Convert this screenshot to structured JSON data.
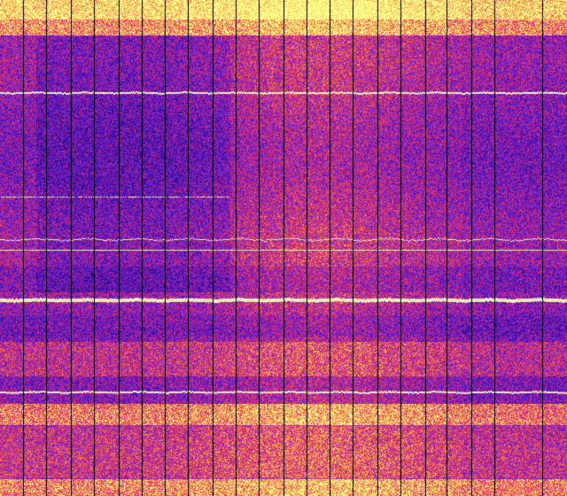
{
  "image": {
    "kind": "spectrogram-waterfall",
    "palette": [
      "#2a0a6e",
      "#3a10c8",
      "#7a20c0",
      "#c02890",
      "#f04060",
      "#ffb040",
      "#ffff90"
    ],
    "accent_colors": {
      "background_high": "#f5f08a",
      "band_low": "#3018c0",
      "band_mid": "#c02a8a",
      "line_bright": "#ffffe0",
      "separator": "#000000"
    },
    "vertical_separator_count": 22,
    "horizontal_bright_line_count": 4
  }
}
